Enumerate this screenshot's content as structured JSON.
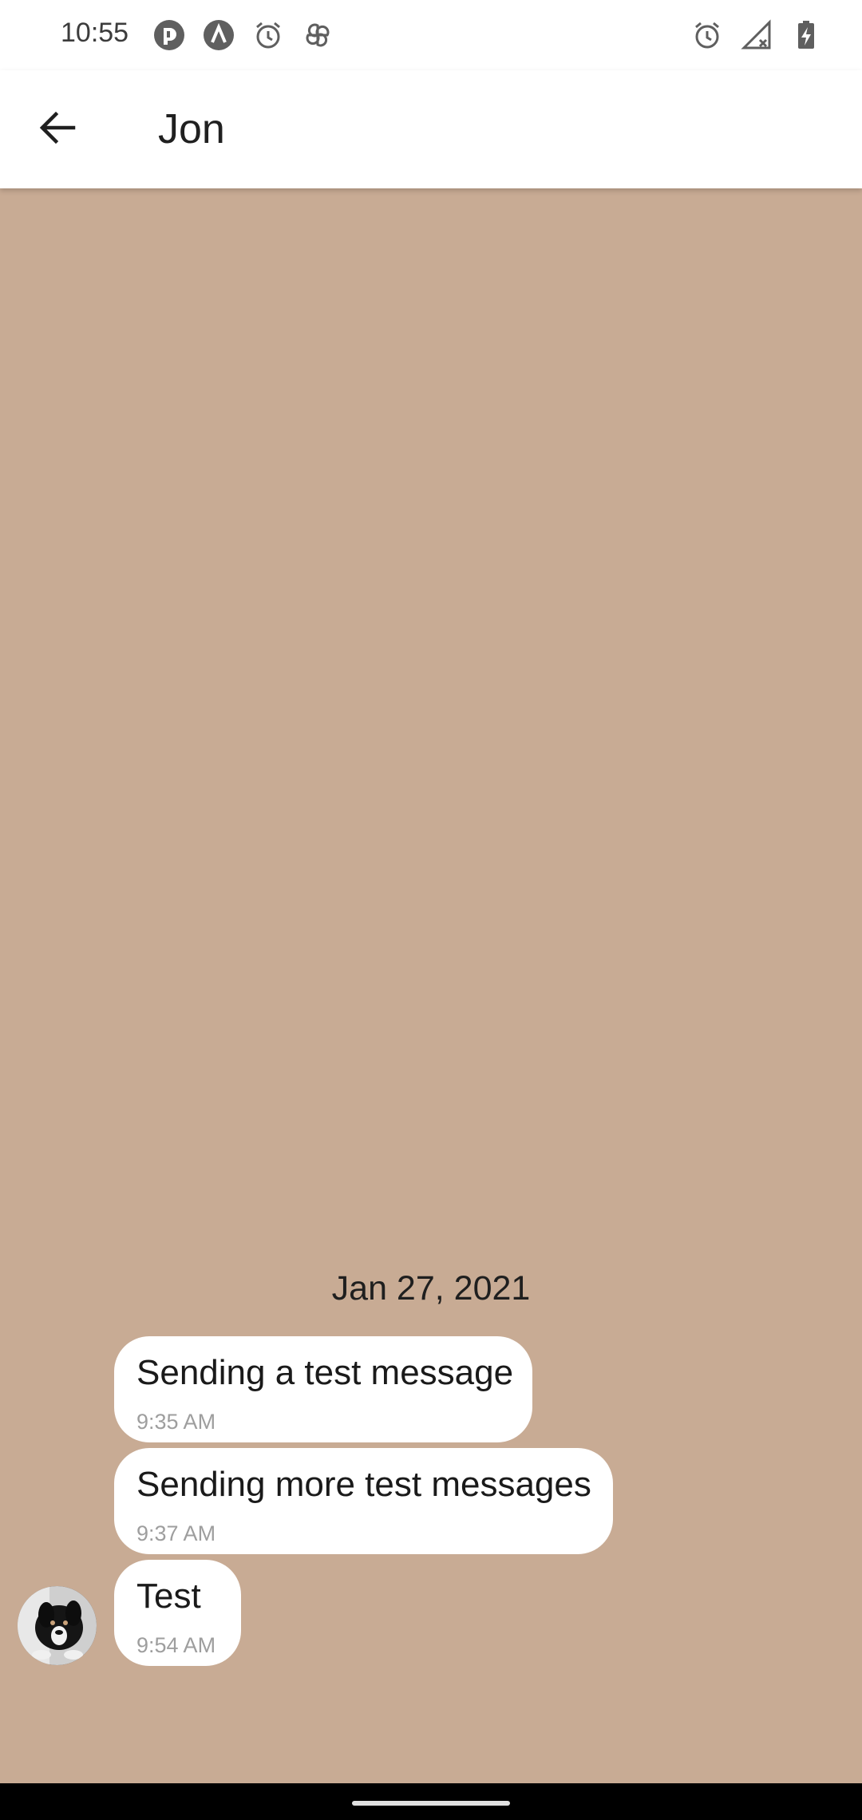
{
  "status_bar": {
    "time": "10:55",
    "left_icons": [
      "pocket-casts-icon",
      "app-a-icon",
      "alarm-icon",
      "pinwheel-icon"
    ],
    "right_icons": [
      "alarm-icon",
      "signal-off-icon",
      "battery-charging-icon"
    ]
  },
  "header": {
    "title": "Jon",
    "back_icon": "arrow-back-icon"
  },
  "conversation": {
    "date_separator": "Jan 27, 2021",
    "messages": [
      {
        "text": "Sending a test message",
        "time": "9:35 AM"
      },
      {
        "text": "Sending more test messages",
        "time": "9:37 AM"
      },
      {
        "text": "Test",
        "time": "9:54 AM"
      }
    ]
  },
  "colors": {
    "chat_background": "#c8ab94",
    "bubble": "#ffffff",
    "app_bar": "#ffffff"
  }
}
